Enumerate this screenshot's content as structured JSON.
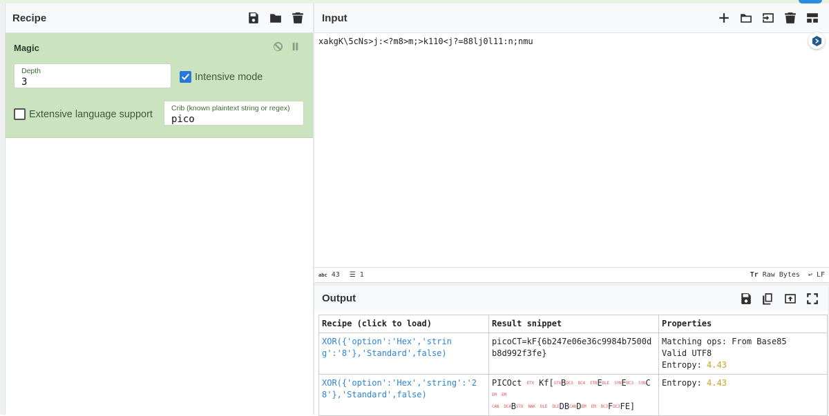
{
  "recipe": {
    "title": "Recipe",
    "icons": [
      "save-icon",
      "folder-icon",
      "trash-icon"
    ],
    "operation": {
      "name": "Magic",
      "depth_label": "Depth",
      "depth_value": "3",
      "intensive_label": "Intensive mode",
      "intensive_checked": true,
      "extensive_label": "Extensive language support",
      "extensive_checked": false,
      "crib_label": "Crib (known plaintext string or regex)",
      "crib_value": "pico"
    }
  },
  "input": {
    "title": "Input",
    "icons": [
      "plus-icon",
      "folder-icon",
      "import-icon",
      "trash-icon",
      "layout-icon"
    ],
    "text": "xakgK\\5cNs>j:<?m8>m;>k110<j?=88lj0l11:n;nmu",
    "stats": {
      "abc_label": "abc",
      "chars": "43",
      "lines": "1"
    },
    "raw_bytes_label": "Raw Bytes",
    "eol_label": "LF"
  },
  "output": {
    "title": "Output",
    "icons": [
      "save-icon",
      "copy-icon",
      "replace-input-icon",
      "fullscreen-icon"
    ],
    "table": {
      "headers": [
        "Recipe (click to load)",
        "Result snippet",
        "Properties"
      ],
      "rows": [
        {
          "recipe": "XOR({'option':'Hex','string':'8'},'Standard',false)",
          "snippet": "picoCT=kF{6b247e06e36c9984b7500db8d992f3fe}",
          "prop_line1": "Matching ops: From Base85",
          "prop_line2": "Valid UTF8",
          "entropy_label": "Entropy: ",
          "entropy_value": "4.43"
        },
        {
          "recipe": "XOR({'option':'Hex','string':'28'},'Standard',false)",
          "snippet_parts": [
            "PICOct",
            "Kf[",
            "B",
            "E",
            "E",
            "C",
            "B",
            "DB",
            "D",
            "F",
            "FE]"
          ],
          "ctl": [
            "ETX",
            "STX",
            "DC3",
            "DC4",
            "ETB",
            "DLE",
            "SYN",
            "DC3",
            "SYN",
            "EM",
            "EM",
            "CAN",
            "DC4",
            "STX",
            "NAK",
            "DLE",
            "DLE",
            "CAN",
            "EM",
            "EM",
            "DC3",
            "DC3"
          ],
          "entropy_label": "Entropy: ",
          "entropy_value": "4.43"
        }
      ]
    }
  }
}
